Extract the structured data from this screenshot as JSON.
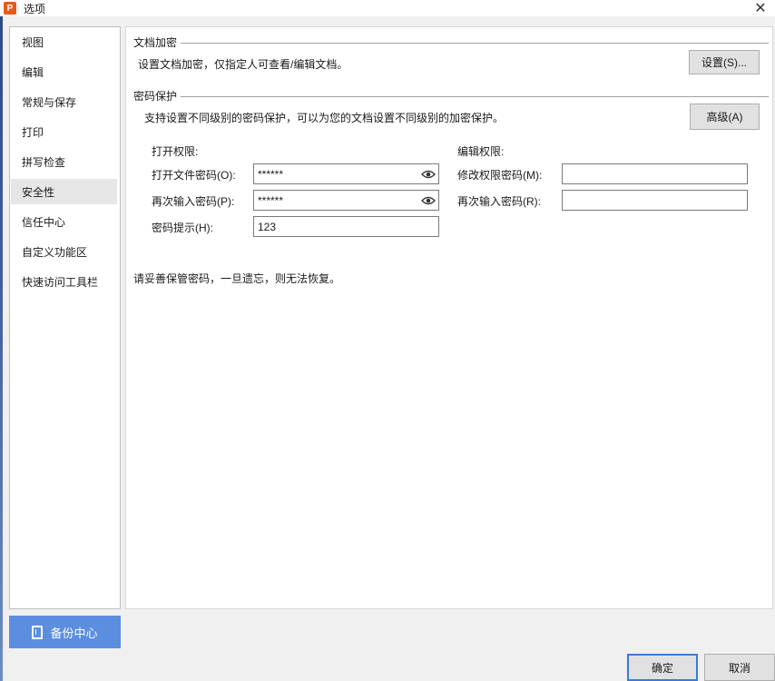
{
  "window": {
    "title": "选项",
    "app_icon_letter": "P",
    "close_symbol": "✕"
  },
  "sidebar": {
    "items": [
      {
        "label": "视图"
      },
      {
        "label": "编辑"
      },
      {
        "label": "常规与保存"
      },
      {
        "label": "打印"
      },
      {
        "label": "拼写检查"
      },
      {
        "label": "安全性",
        "active": true
      },
      {
        "label": "信任中心"
      },
      {
        "label": "自定义功能区"
      },
      {
        "label": "快速访问工具栏"
      }
    ],
    "backup_button": "备份中心"
  },
  "encryption": {
    "heading": "文档加密",
    "description": "设置文档加密，仅指定人可查看/编辑文档。",
    "settings_button": "设置(S)..."
  },
  "password_protection": {
    "heading": "密码保护",
    "description": "支持设置不同级别的密码保护，可以为您的文档设置不同级别的加密保护。",
    "advanced_button": "高级(A)",
    "open_permission": {
      "heading": "打开权限:",
      "password_label": "打开文件密码(O):",
      "password_value": "******",
      "confirm_label": "再次输入密码(P):",
      "confirm_value": "******",
      "hint_label": "密码提示(H):",
      "hint_value": "123"
    },
    "edit_permission": {
      "heading": "编辑权限:",
      "password_label": "修改权限密码(M):",
      "password_value": "",
      "confirm_label": "再次输入密码(R):",
      "confirm_value": ""
    },
    "warning": "请妥善保管密码，一旦遗忘，则无法恢复。"
  },
  "footer": {
    "ok_button": "确定",
    "cancel_button": "取消"
  },
  "icons": {
    "eye": "eye-icon",
    "backup": "backup-icon",
    "close": "close-icon"
  },
  "colors": {
    "accent": "#5c8ee0",
    "app_icon": "#e8591a",
    "primary_border": "#3a7bd5"
  }
}
